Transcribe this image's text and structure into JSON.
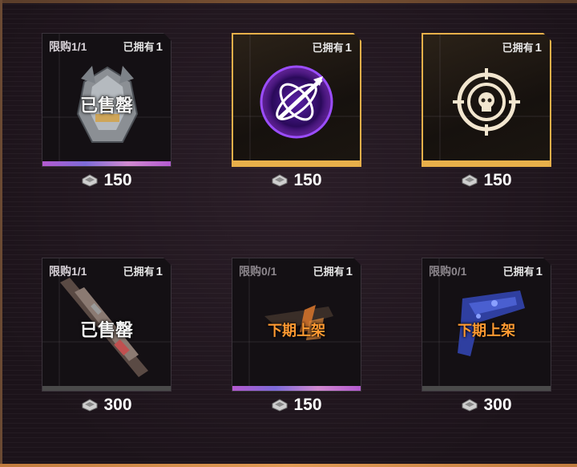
{
  "items": [
    {
      "limit": "限购1/1",
      "owned_label": "已拥有",
      "owned_count": "1",
      "status": "已售罄",
      "price": "150",
      "icon": "mech-helmet-icon",
      "bar": "rainbow",
      "frame": "grey"
    },
    {
      "limit": "",
      "owned_label": "已拥有",
      "owned_count": "1",
      "status": "",
      "price": "150",
      "icon": "missile-emblem-icon",
      "bar": "gold",
      "frame": "gold"
    },
    {
      "limit": "",
      "owned_label": "已拥有",
      "owned_count": "1",
      "status": "",
      "price": "150",
      "icon": "skull-crosshair-icon",
      "bar": "gold",
      "frame": "gold"
    },
    {
      "limit": "限购1/1",
      "owned_label": "已拥有",
      "owned_count": "1",
      "status": "已售罄",
      "price": "300",
      "icon": "rifle-icon",
      "bar": "grey",
      "frame": "grey"
    },
    {
      "limit": "限购0/1",
      "owned_label": "已拥有",
      "owned_count": "1",
      "status": "下期上架",
      "price": "150",
      "icon": "gun-icon",
      "bar": "rainbow",
      "frame": "grey"
    },
    {
      "limit": "限购0/1",
      "owned_label": "已拥有",
      "owned_count": "1",
      "status": "下期上架",
      "price": "300",
      "icon": "blue-pistol-icon",
      "bar": "grey",
      "frame": "grey"
    }
  ],
  "currency_icon": "currency-chip-icon",
  "colors": {
    "gold": "#e8b04a",
    "orange_status": "#ff9a32",
    "purple_glow": "#8a2be2"
  }
}
